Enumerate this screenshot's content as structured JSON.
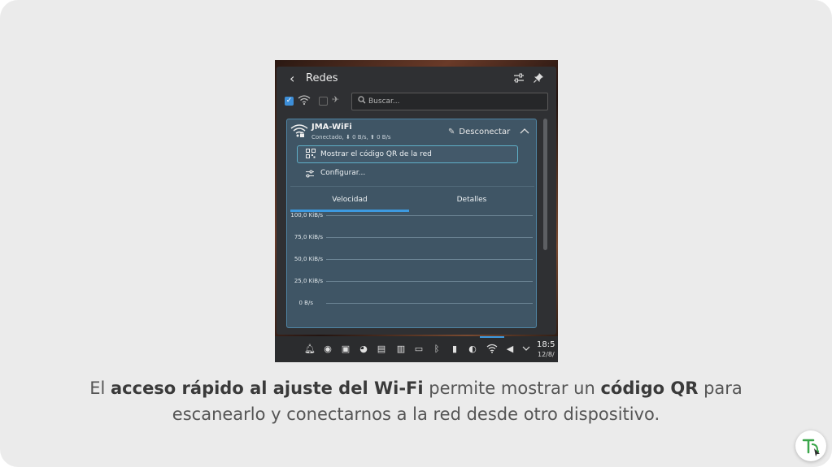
{
  "popup": {
    "title": "Redes",
    "search_placeholder": "Buscar..."
  },
  "network": {
    "name": "JMA-WiFi",
    "status": "Conectado, ⬇ 0 B/s, ⬆ 0 B/s",
    "disconnect_label": "Desconectar",
    "qr_label": "Mostrar el código QR de la red",
    "configure_label": "Configurar...",
    "tabs": [
      {
        "label": "Velocidad",
        "active": true
      },
      {
        "label": "Detalles",
        "active": false
      }
    ],
    "speed_axis": [
      "100,0 KiB/s",
      "75,0 KiB/s",
      "50,0 KiB/s",
      "25,0 KiB/s",
      "0 B/s"
    ]
  },
  "taskbar": {
    "clock_time": "18:5",
    "clock_date": "12/8/"
  },
  "caption": {
    "part1": "El ",
    "bold1": "acceso rápido al ajuste del Wi-Fi",
    "part2": " permite mostrar un ",
    "bold2": "código QR",
    "part3": " para escanearlo y conectarnos a la red desde otro dispositivo."
  },
  "colors": {
    "card_bg": "#ebebeb",
    "panel_bg": "#2f3033",
    "network_bg": "#3f5565",
    "accent": "#3d9ae0"
  }
}
